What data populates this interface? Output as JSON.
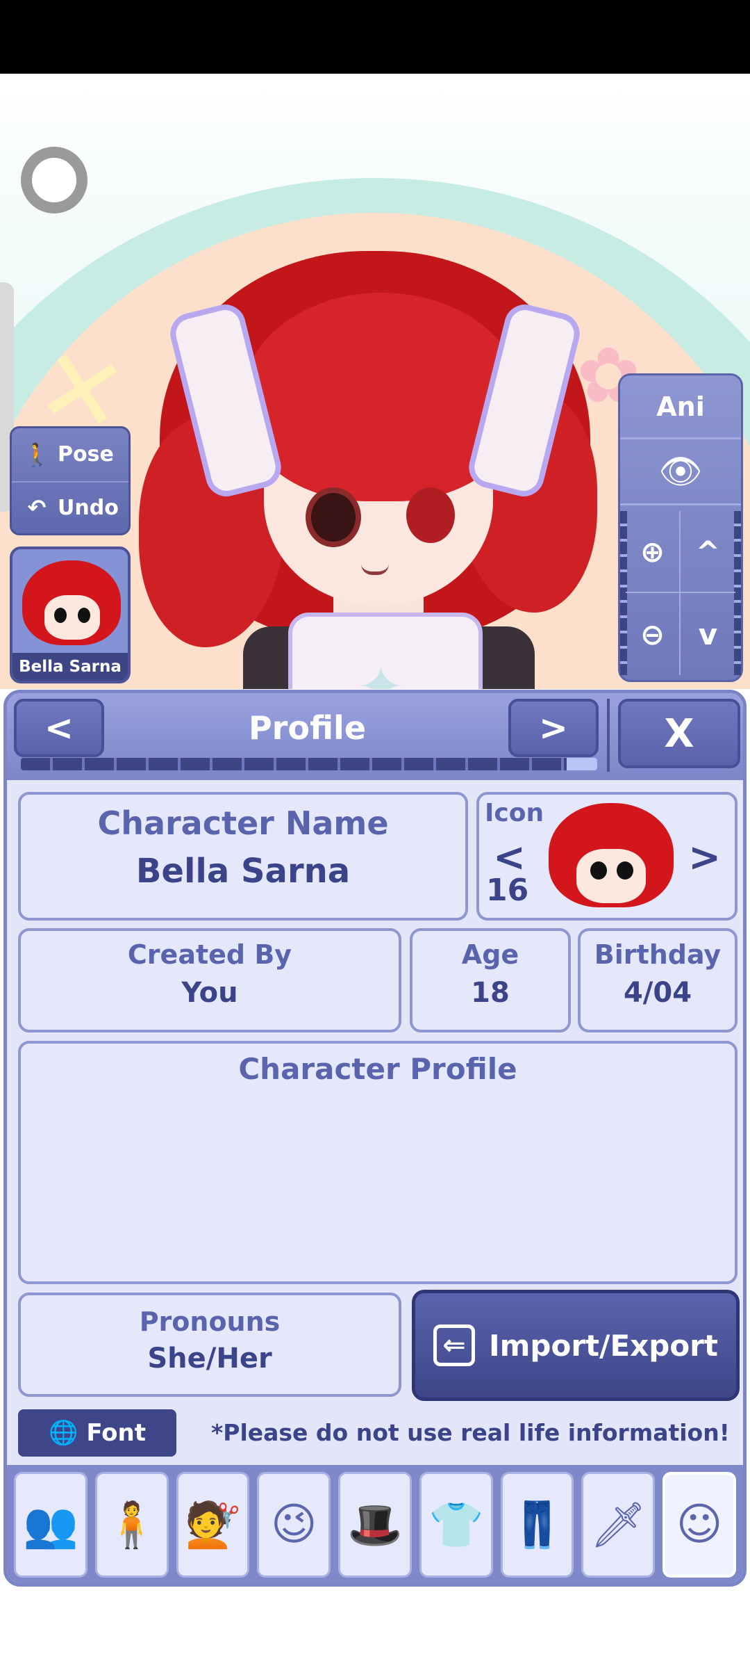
{
  "stage": {
    "pose_label": "Pose",
    "undo_label": "Undo",
    "character_thumb_name": "Bella Sarna",
    "camera": {
      "ani_label": "Ani",
      "zoom_in": "⊕",
      "zoom_out": "⊖",
      "up": "^",
      "down": "v"
    }
  },
  "panel": {
    "title": "Profile",
    "prev": "<",
    "next": ">",
    "close": "X",
    "progress_fraction": 0.97
  },
  "profile": {
    "name_label": "Character Name",
    "name_value": "Bella Sarna",
    "icon_label": "Icon",
    "icon_prev": "<",
    "icon_next": ">",
    "icon_number": "16",
    "created_label": "Created By",
    "created_value": "You",
    "age_label": "Age",
    "age_value": "18",
    "birthday_label": "Birthday",
    "birthday_value": "4/04",
    "character_profile_label": "Character Profile",
    "character_profile_value": "",
    "pronouns_label": "Pronouns",
    "pronouns_value": "She/Her",
    "import_export_label": "Import/Export",
    "font_label": "Font",
    "note": "*Please do not use real life information!"
  },
  "toolbar": {
    "tools": [
      {
        "name": "presets",
        "glyph": "👥"
      },
      {
        "name": "body",
        "glyph": "🧍"
      },
      {
        "name": "hair",
        "glyph": "💇"
      },
      {
        "name": "face",
        "glyph": "😉"
      },
      {
        "name": "accessories",
        "glyph": "🎩"
      },
      {
        "name": "top",
        "glyph": "👕"
      },
      {
        "name": "bottom",
        "glyph": "👖"
      },
      {
        "name": "props",
        "glyph": "🗡"
      },
      {
        "name": "profile",
        "glyph": "☺"
      }
    ],
    "active": "profile"
  },
  "colors": {
    "accent": "#3e4689",
    "panel_bg": "#e3e6f8",
    "header": "#7c86c9",
    "hair": "#d3161c"
  }
}
